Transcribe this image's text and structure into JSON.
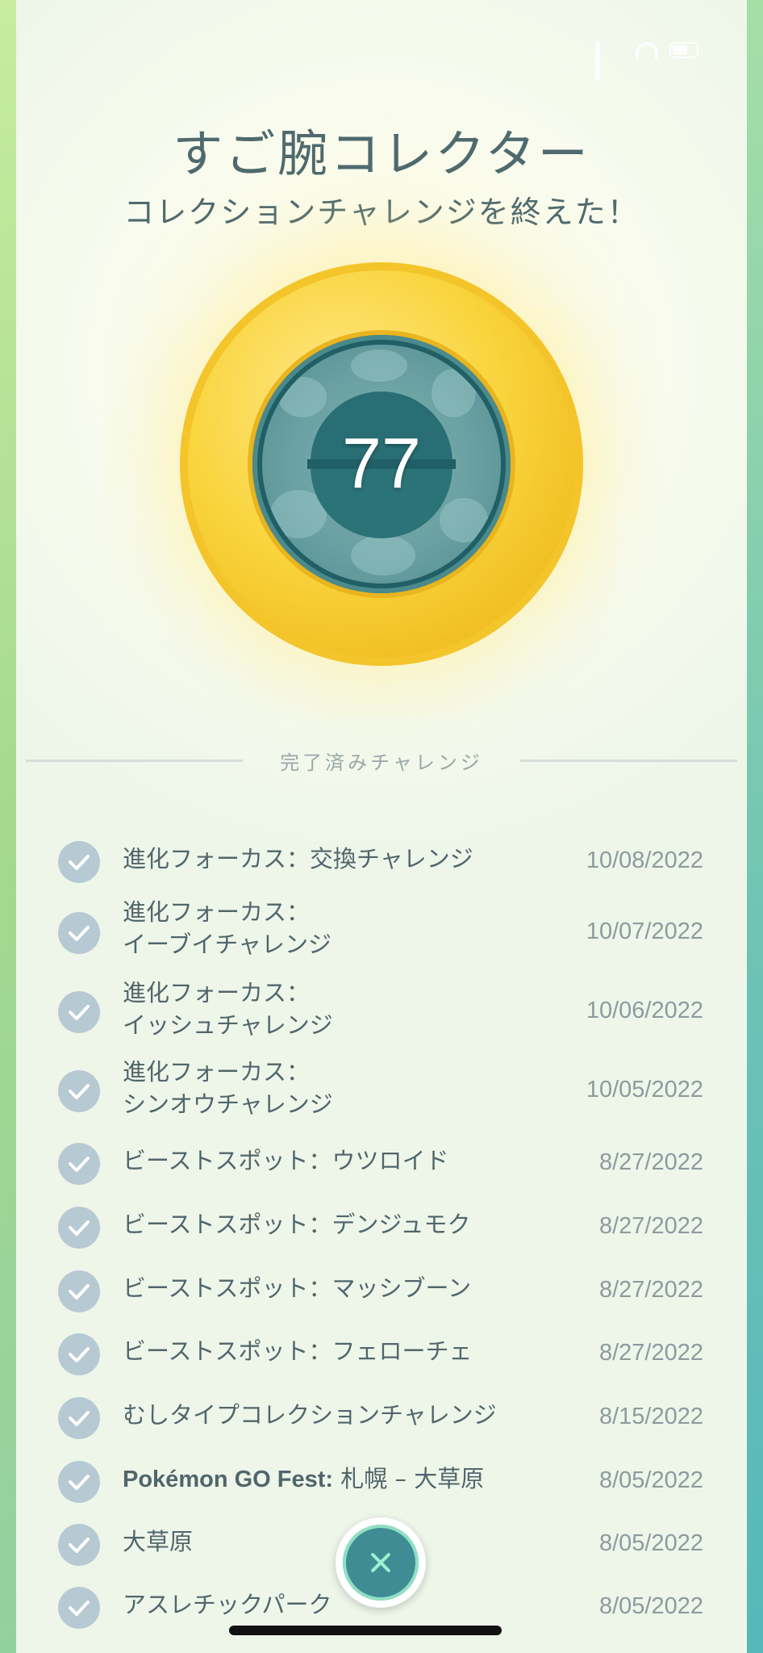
{
  "header": {
    "title": "すご腕コレクター",
    "subtitle": "コレクションチャレンジを終えた！"
  },
  "medal": {
    "count": "77",
    "colors": {
      "gold": "#f9d43c",
      "center": "#1f5f65"
    }
  },
  "section": {
    "label": "完了済みチャレンジ"
  },
  "challenges": [
    {
      "label": "進化フォーカス：交換チャレンジ",
      "date": "10/08/2022"
    },
    {
      "label": "進化フォーカス：\nイーブイチャレンジ",
      "date": "10/07/2022"
    },
    {
      "label": "進化フォーカス：\nイッシュチャレンジ",
      "date": "10/06/2022"
    },
    {
      "label": "進化フォーカス：\nシンオウチャレンジ",
      "date": "10/05/2022"
    },
    {
      "label": "ビーストスポット：ウツロイド",
      "date": "8/27/2022"
    },
    {
      "label": "ビーストスポット：デンジュモク",
      "date": "8/27/2022"
    },
    {
      "label": "ビーストスポット：マッシブーン",
      "date": "8/27/2022"
    },
    {
      "label": "ビーストスポット：フェローチェ",
      "date": "8/27/2022"
    },
    {
      "label": "むしタイプコレクションチャレンジ",
      "date": "8/15/2022"
    },
    {
      "label_bold": "Pokémon GO Fest:",
      "label": " 札幌 – 大草原",
      "date": "8/05/2022"
    },
    {
      "label": "大草原",
      "date": "8/05/2022"
    },
    {
      "label": "アスレチックパーク",
      "date": "8/05/2022"
    }
  ],
  "icons": {
    "check": "check-icon",
    "close": "close-icon"
  }
}
